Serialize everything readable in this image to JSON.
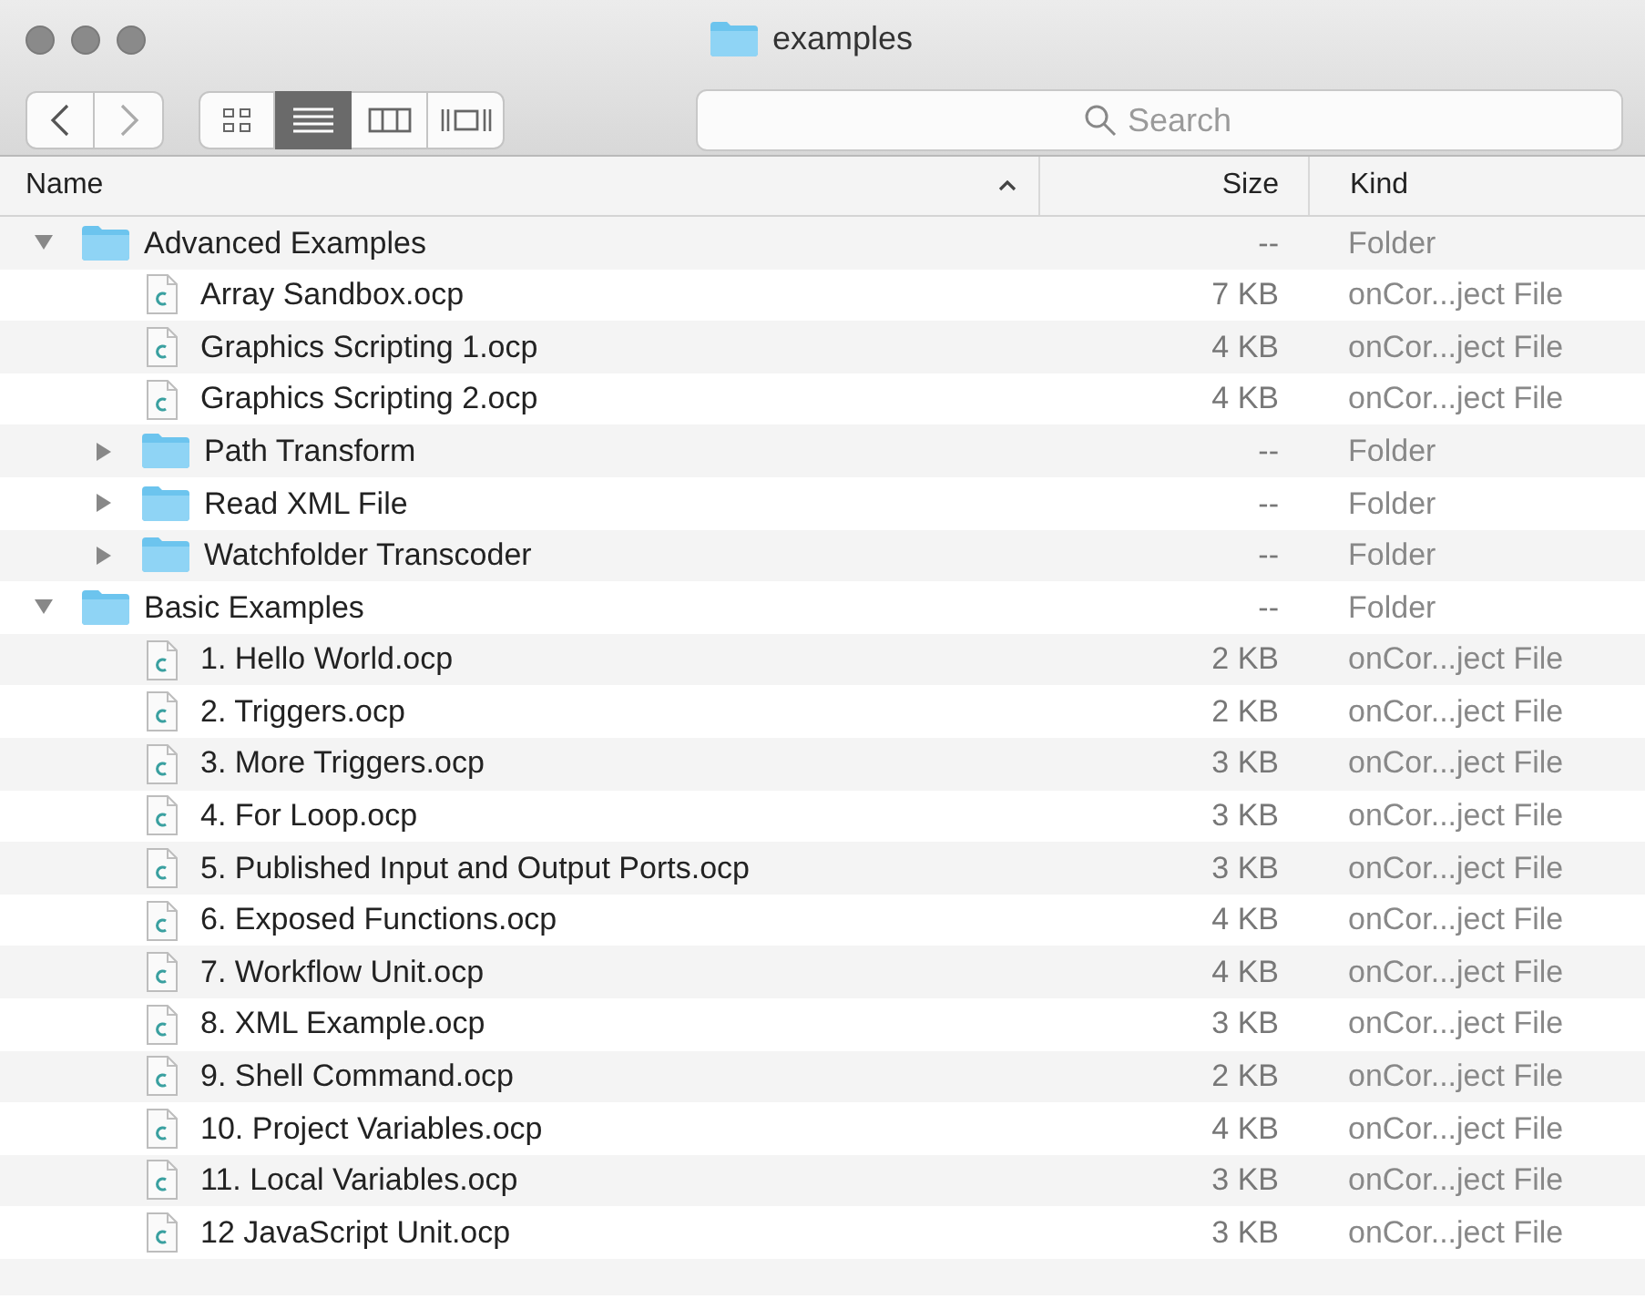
{
  "window": {
    "title": "examples"
  },
  "toolbar": {
    "view_modes": [
      {
        "kind": "icons",
        "selected": false
      },
      {
        "kind": "list",
        "selected": true
      },
      {
        "kind": "columns",
        "selected": false
      },
      {
        "kind": "coverflow",
        "selected": false
      }
    ],
    "search": {
      "placeholder": "Search"
    }
  },
  "table": {
    "columns": [
      {
        "label": "Name",
        "sorted": true
      },
      {
        "label": "Size",
        "sorted": false
      },
      {
        "label": "Kind",
        "sorted": false
      }
    ],
    "rows": [
      {
        "kind": "folder",
        "name": "Advanced Examples",
        "size": "--",
        "type": "Folder",
        "expanded": true,
        "children": [
          {
            "kind": "file",
            "name": "Array Sandbox.ocp",
            "size": "7 KB",
            "type": "onCor...ject File"
          },
          {
            "kind": "file",
            "name": "Graphics Scripting 1.ocp",
            "size": "4 KB",
            "type": "onCor...ject File"
          },
          {
            "kind": "file",
            "name": "Graphics Scripting 2.ocp",
            "size": "4 KB",
            "type": "onCor...ject File"
          },
          {
            "kind": "folder",
            "name": "Path Transform",
            "size": "--",
            "type": "Folder",
            "expanded": false
          },
          {
            "kind": "folder",
            "name": "Read XML File",
            "size": "--",
            "type": "Folder",
            "expanded": false
          },
          {
            "kind": "folder",
            "name": "Watchfolder Transcoder",
            "size": "--",
            "type": "Folder",
            "expanded": false
          }
        ]
      },
      {
        "kind": "folder",
        "name": "Basic Examples",
        "size": "--",
        "type": "Folder",
        "expanded": true,
        "children": [
          {
            "kind": "file",
            "name": "1. Hello World.ocp",
            "size": "2 KB",
            "type": "onCor...ject File"
          },
          {
            "kind": "file",
            "name": "2. Triggers.ocp",
            "size": "2 KB",
            "type": "onCor...ject File"
          },
          {
            "kind": "file",
            "name": "3. More Triggers.ocp",
            "size": "3 KB",
            "type": "onCor...ject File"
          },
          {
            "kind": "file",
            "name": "4. For Loop.ocp",
            "size": "3 KB",
            "type": "onCor...ject File"
          },
          {
            "kind": "file",
            "name": "5. Published Input and Output Ports.ocp",
            "size": "3 KB",
            "type": "onCor...ject File"
          },
          {
            "kind": "file",
            "name": "6. Exposed Functions.ocp",
            "size": "4 KB",
            "type": "onCor...ject File"
          },
          {
            "kind": "file",
            "name": "7. Workflow Unit.ocp",
            "size": "4 KB",
            "type": "onCor...ject File"
          },
          {
            "kind": "file",
            "name": "8. XML Example.ocp",
            "size": "3 KB",
            "type": "onCor...ject File"
          },
          {
            "kind": "file",
            "name": "9. Shell Command.ocp",
            "size": "2 KB",
            "type": "onCor...ject File"
          },
          {
            "kind": "file",
            "name": "10. Project Variables.ocp",
            "size": "4 KB",
            "type": "onCor...ject File"
          },
          {
            "kind": "file",
            "name": "11. Local Variables.ocp",
            "size": "3 KB",
            "type": "onCor...ject File"
          },
          {
            "kind": "file",
            "name": "12 JavaScript Unit.ocp",
            "size": "3 KB",
            "type": "onCor...ject File"
          }
        ]
      }
    ]
  }
}
